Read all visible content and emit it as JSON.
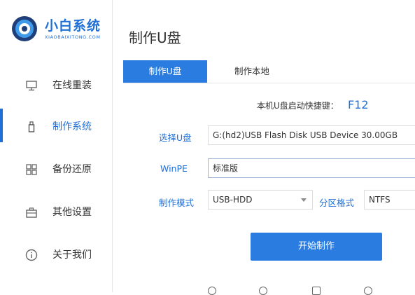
{
  "brand": {
    "title": "小白系统",
    "subtitle": "XIAOBAIXITONG.COM"
  },
  "sidebar": {
    "items": [
      {
        "label": "在线重装",
        "icon": "monitor-icon"
      },
      {
        "label": "制作系统",
        "icon": "usb-drive-icon",
        "active": true
      },
      {
        "label": "备份还原",
        "icon": "grid-icon"
      },
      {
        "label": "其他设置",
        "icon": "briefcase-icon"
      },
      {
        "label": "关于我们",
        "icon": "info-icon"
      }
    ]
  },
  "main": {
    "title": "制作U盘",
    "tabs": [
      {
        "label": "制作U盘",
        "active": true
      },
      {
        "label": "制作本地",
        "active": false
      }
    ],
    "hint": {
      "text": "本机U盘启动快捷键：",
      "key": "F12"
    },
    "form": {
      "usb_label": "选择U盘",
      "usb_value": "G:(hd2)USB Flash Disk USB Device 30.00GB",
      "winpe_label": "WinPE",
      "winpe_value": "标准版",
      "mode_label": "制作模式",
      "mode_value": "USB-HDD",
      "partition_label": "分区格式",
      "partition_value": "NTFS"
    },
    "start_button": "开始制作"
  },
  "colors": {
    "accent": "#2b7ce0",
    "brand": "#1f6fd6"
  }
}
